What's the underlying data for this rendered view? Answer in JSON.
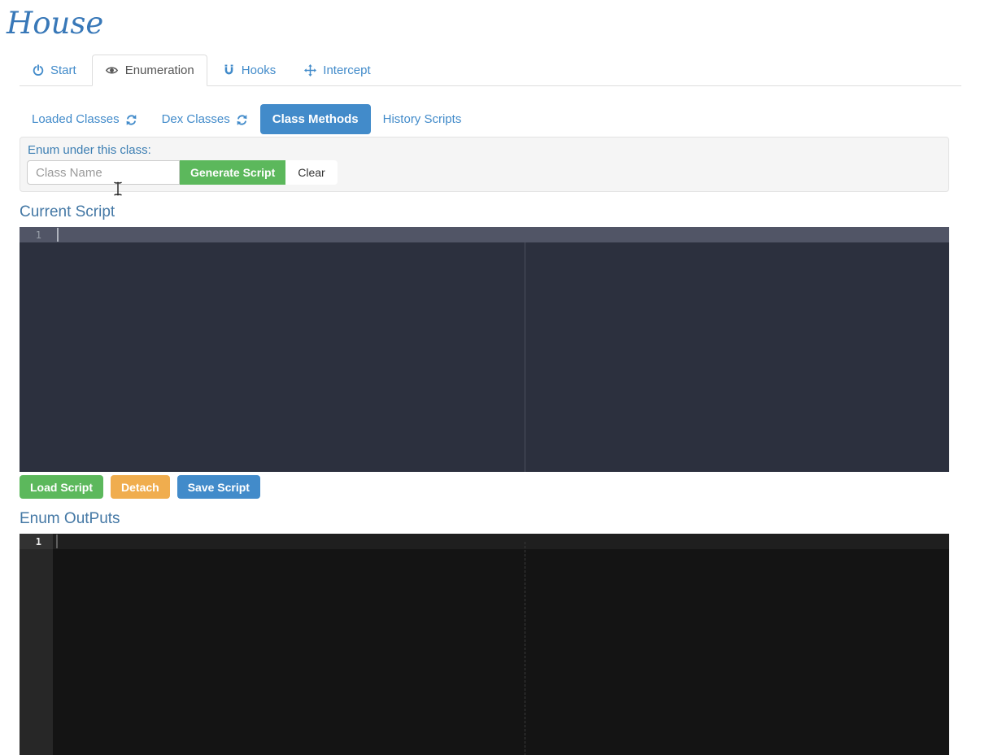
{
  "app": {
    "title": "House"
  },
  "tabs": [
    {
      "label": "Start",
      "icon": "power-icon",
      "active": false
    },
    {
      "label": "Enumeration",
      "icon": "eye-icon",
      "active": true
    },
    {
      "label": "Hooks",
      "icon": "magnet-icon",
      "active": false
    },
    {
      "label": "Intercept",
      "icon": "move-icon",
      "active": false
    }
  ],
  "subnav": [
    {
      "label": "Loaded Classes",
      "icon": "refresh-icon",
      "active": false
    },
    {
      "label": "Dex Classes",
      "icon": "refresh-icon",
      "active": false
    },
    {
      "label": "Class Methods",
      "icon": null,
      "active": true
    },
    {
      "label": "History Scripts",
      "icon": null,
      "active": false
    }
  ],
  "enum_form": {
    "label": "Enum under this class:",
    "class_name_value": "",
    "class_name_placeholder": "Class Name",
    "generate_button": "Generate Script",
    "clear_button": "Clear"
  },
  "current_script": {
    "heading": "Current Script",
    "line_number": "1",
    "content": ""
  },
  "script_actions": {
    "load_button": "Load Script",
    "detach_button": "Detach",
    "save_button": "Save Script"
  },
  "enum_outputs": {
    "heading": "Enum OutPuts",
    "line_number": "1",
    "content": ""
  },
  "colors": {
    "brand_blue": "#3878b8",
    "link_blue": "#428bca",
    "heading_blue": "#4478a5",
    "green": "#5cb85c",
    "orange": "#f0ad4e",
    "button_blue": "#428bca",
    "editor_dark_bg": "#2c303e",
    "editor_dark_active_line": "#515566",
    "editor_black_bg": "#141414",
    "editor_black_gutter": "#272727",
    "well_bg": "#f5f5f5"
  }
}
